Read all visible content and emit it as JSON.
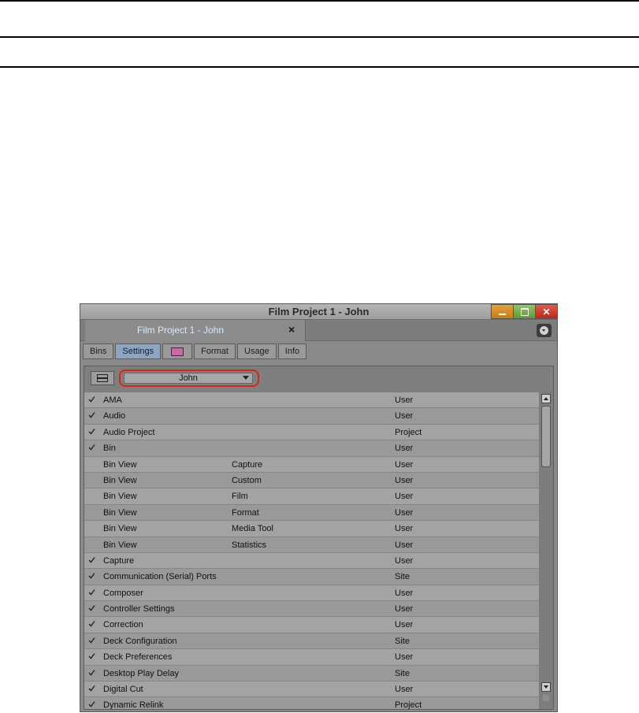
{
  "window": {
    "title": "Film Project 1 - John"
  },
  "doc_tab": {
    "label": "Film Project 1 - John",
    "close_glyph": "×"
  },
  "subtabs": [
    {
      "label": "Bins"
    },
    {
      "label": "Settings",
      "active": true
    },
    {
      "label": "",
      "icon": "color-swatch-icon"
    },
    {
      "label": "Format"
    },
    {
      "label": "Usage"
    },
    {
      "label": "Info"
    }
  ],
  "user_select": {
    "value": "John"
  },
  "settings": [
    {
      "checked": true,
      "name": "AMA",
      "sub": "",
      "kind": "User"
    },
    {
      "checked": true,
      "name": "Audio",
      "sub": "",
      "kind": "User"
    },
    {
      "checked": true,
      "name": "Audio Project",
      "sub": "",
      "kind": "Project"
    },
    {
      "checked": true,
      "name": "Bin",
      "sub": "",
      "kind": "User"
    },
    {
      "checked": false,
      "name": "Bin View",
      "sub": "Capture",
      "kind": "User"
    },
    {
      "checked": false,
      "name": "Bin View",
      "sub": "Custom",
      "kind": "User"
    },
    {
      "checked": false,
      "name": "Bin View",
      "sub": "Film",
      "kind": "User"
    },
    {
      "checked": false,
      "name": "Bin View",
      "sub": "Format",
      "kind": "User"
    },
    {
      "checked": false,
      "name": "Bin View",
      "sub": "Media Tool",
      "kind": "User"
    },
    {
      "checked": false,
      "name": "Bin View",
      "sub": "Statistics",
      "kind": "User"
    },
    {
      "checked": true,
      "name": "Capture",
      "sub": "",
      "kind": "User"
    },
    {
      "checked": true,
      "name": "Communication (Serial) Ports",
      "sub": "",
      "kind": "Site"
    },
    {
      "checked": true,
      "name": "Composer",
      "sub": "",
      "kind": "User"
    },
    {
      "checked": true,
      "name": "Controller Settings",
      "sub": "",
      "kind": "User"
    },
    {
      "checked": true,
      "name": "Correction",
      "sub": "",
      "kind": "User"
    },
    {
      "checked": true,
      "name": "Deck Configuration",
      "sub": "",
      "kind": "Site"
    },
    {
      "checked": true,
      "name": "Deck Preferences",
      "sub": "",
      "kind": "User"
    },
    {
      "checked": true,
      "name": "Desktop Play Delay",
      "sub": "",
      "kind": "Site"
    },
    {
      "checked": true,
      "name": "Digital Cut",
      "sub": "",
      "kind": "User"
    },
    {
      "checked": true,
      "name": "Dynamic Relink",
      "sub": "",
      "kind": "Project"
    }
  ],
  "colors": {
    "highlight_ring": "#d9231d",
    "active_tab": "#8fa4bf",
    "doc_tab_text": "#d8e8ff"
  }
}
